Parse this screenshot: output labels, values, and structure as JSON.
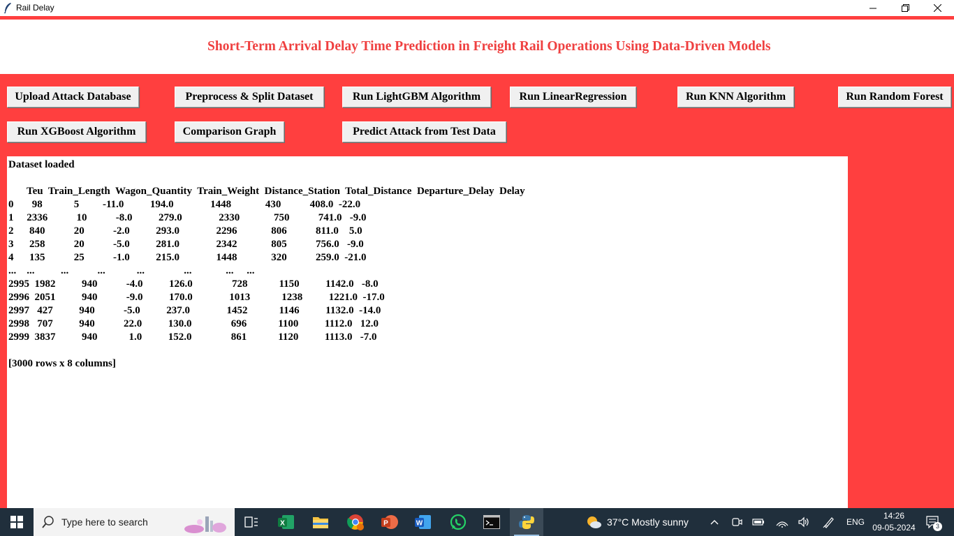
{
  "window": {
    "title": "Rail Delay"
  },
  "header": {
    "heading": "Short-Term Arrival Delay Time Prediction in Freight Rail Operations Using Data-Driven Models",
    "heading_color": "#ef4040"
  },
  "colors": {
    "background": "#ff3f3f",
    "taskbar": "#202f3c"
  },
  "buttons": {
    "upload": "Upload Attack Database",
    "preprocess": "Preprocess & Split Dataset",
    "lightgbm": "Run LightGBM Algorithm",
    "linear": "Run LinearRegression",
    "knn": "Run KNN Algorithm",
    "random_forest": "Run Random Forest",
    "xgboost": "Run XGBoost Algorithm",
    "comparison": "Comparison Graph",
    "predict": "Predict Attack from Test Data"
  },
  "output": {
    "lines": [
      "Dataset loaded",
      "",
      "       Teu  Train_Length  Wagon_Quantity  Train_Weight  Distance_Station  Total_Distance  Departure_Delay  Delay",
      "0       98            5         -11.0          194.0              1448             430           408.0  -22.0",
      "1     2336           10           -8.0          279.0              2330             750           741.0   -9.0",
      "2      840           20           -2.0          293.0              2296             806           811.0    5.0",
      "3      258           20           -5.0          281.0              2342             805           756.0   -9.0",
      "4      135           25           -1.0          215.0              1448             320           259.0  -21.0",
      "...    ...          ...           ...            ...               ...             ...     ...",
      "2995  1982          940           -4.0          126.0               728            1150          1142.0   -8.0",
      "2996  2051          940           -9.0          170.0              1013            1238          1221.0  -17.0",
      "2997   427          940           -5.0          237.0              1452            1146          1132.0  -14.0",
      "2998   707          940           22.0          130.0               696            1100          1112.0   12.0",
      "2999  3837          940            1.0          152.0               861            1120          1113.0   -7.0",
      "",
      "[3000 rows x 8 columns]"
    ]
  },
  "taskbar": {
    "search_placeholder": "Type here to search",
    "weather": "37°C  Mostly sunny",
    "language": "ENG",
    "time": "14:26",
    "date": "09-05-2024",
    "notification_count": "3",
    "apps": [
      "task-view-icon",
      "excel-icon",
      "file-explorer-icon",
      "chrome-icon",
      "powerpoint-icon",
      "word-icon",
      "whatsapp-icon",
      "terminal-icon",
      "python-icon"
    ]
  }
}
